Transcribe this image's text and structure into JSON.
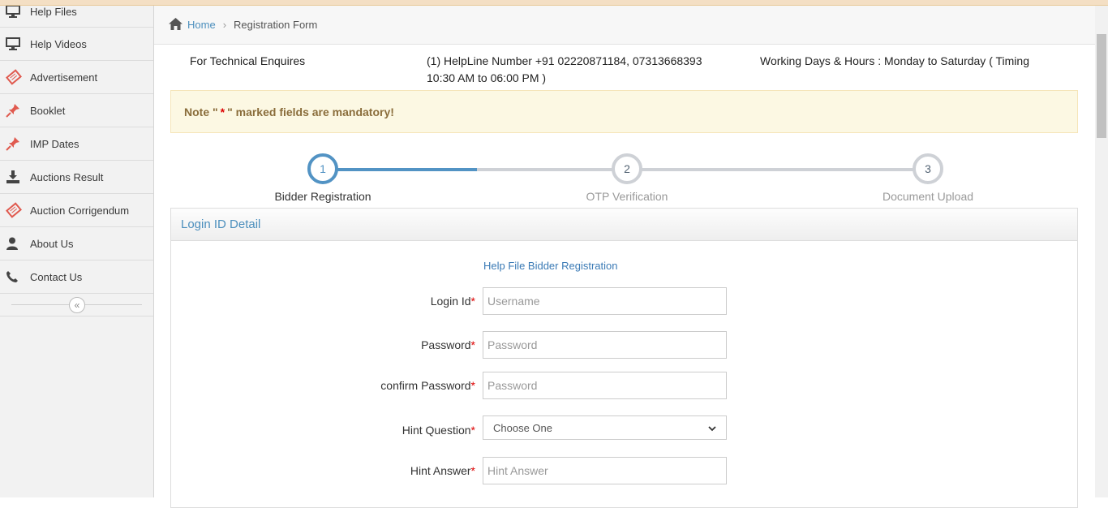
{
  "sidebar": {
    "items": [
      {
        "label": "Help Files",
        "icon": "monitor-icon"
      },
      {
        "label": "Help Videos",
        "icon": "monitor-icon"
      },
      {
        "label": "Advertisement",
        "icon": "ticket-icon"
      },
      {
        "label": "Booklet",
        "icon": "pin-icon"
      },
      {
        "label": "IMP Dates",
        "icon": "pin-icon"
      },
      {
        "label": "Auctions Result",
        "icon": "download-icon"
      },
      {
        "label": "Auction Corrigendum",
        "icon": "ticket-icon"
      },
      {
        "label": "About Us",
        "icon": "user-icon"
      },
      {
        "label": "Contact Us",
        "icon": "phone-icon"
      }
    ],
    "collapse_glyph": "«"
  },
  "breadcrumb": {
    "home": "Home",
    "separator": "›",
    "current": "Registration Form"
  },
  "info": {
    "technical": "For Technical Enquires",
    "helpline": "(1) HelpLine Number +91 02220871184, 07313668393 10:30 AM to 06:00 PM )",
    "hours": "Working Days & Hours : Monday to Saturday ( Timing"
  },
  "note": {
    "prefix": "Note \"",
    "star": "*",
    "suffix": "\" marked fields are mandatory!"
  },
  "stepper": {
    "steps": [
      {
        "number": "1",
        "label": "Bidder Registration"
      },
      {
        "number": "2",
        "label": "OTP Verification"
      },
      {
        "number": "3",
        "label": "Document Upload"
      }
    ],
    "active_step": 1
  },
  "panel": {
    "title": "Login ID Detail",
    "help_link": "Help File Bidder Registration"
  },
  "form": {
    "required_mark": "*",
    "login_id": {
      "label": "Login Id",
      "placeholder": "Username"
    },
    "password": {
      "label": "Password",
      "placeholder": "Password"
    },
    "confirm_password": {
      "label": "confirm Password",
      "placeholder": "Password"
    },
    "hint_question": {
      "label": "Hint Question",
      "selected": "Choose One"
    },
    "hint_answer": {
      "label": "Hint Answer",
      "placeholder": "Hint Answer"
    }
  },
  "colors": {
    "accent": "#5293c4",
    "link": "#4c8fbd",
    "required": "#dd0000",
    "note_bg": "#fcf8e3"
  }
}
